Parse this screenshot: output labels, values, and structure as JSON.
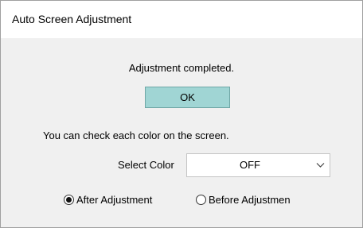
{
  "window": {
    "title": "Auto Screen Adjustment"
  },
  "dialog": {
    "status_message": "Adjustment completed.",
    "ok_label": "OK",
    "check_message": "You can check each color on the screen.",
    "select_color_label": "Select Color",
    "select_color_value": "OFF",
    "radio_options": [
      {
        "label": "After Adjustment",
        "checked": true
      },
      {
        "label": "Before Adjustmen",
        "checked": false
      }
    ]
  },
  "icons": {
    "dropdown": "chevron-down-icon",
    "radio_selected": "radio-checked-icon",
    "radio_unselected": "radio-unchecked-icon"
  },
  "colors": {
    "ok_button_bg": "#a0d5d4",
    "dialog_bg": "#f0f0f0"
  }
}
